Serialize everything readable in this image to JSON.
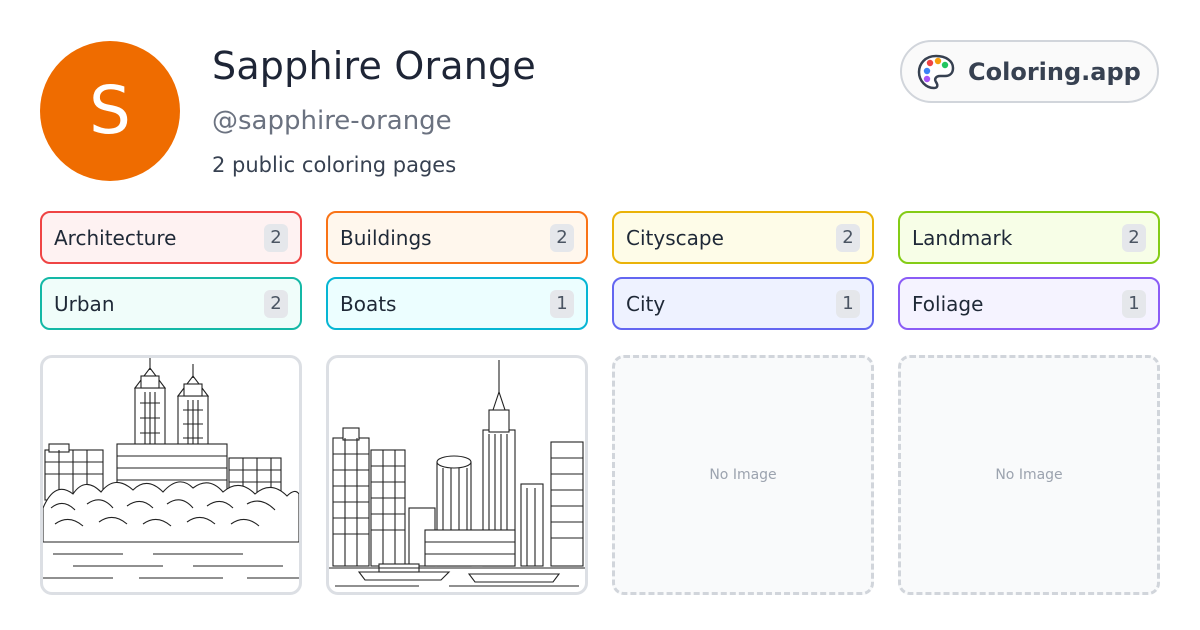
{
  "profile": {
    "initial": "S",
    "avatar_color": "#ef6c00",
    "name": "Sapphire Orange",
    "handle": "@sapphire-orange",
    "page_count": "2 public coloring pages"
  },
  "brand": {
    "label": "Coloring.app",
    "icon": "palette-icon"
  },
  "tags": [
    {
      "label": "Architecture",
      "count": "2",
      "border": "#ef4444",
      "bg": "#fef2f2"
    },
    {
      "label": "Buildings",
      "count": "2",
      "border": "#f97316",
      "bg": "#fff7ed"
    },
    {
      "label": "Cityscape",
      "count": "2",
      "border": "#eab308",
      "bg": "#fefce8"
    },
    {
      "label": "Landmark",
      "count": "2",
      "border": "#84cc16",
      "bg": "#f7fee7"
    },
    {
      "label": "Urban",
      "count": "2",
      "border": "#14b8a6",
      "bg": "#f0fdfa"
    },
    {
      "label": "Boats",
      "count": "1",
      "border": "#06b6d4",
      "bg": "#ecfeff"
    },
    {
      "label": "City",
      "count": "1",
      "border": "#6366f1",
      "bg": "#eef2ff"
    },
    {
      "label": "Foliage",
      "count": "1",
      "border": "#8b5cf6",
      "bg": "#f5f3ff"
    }
  ],
  "cards": [
    {
      "type": "image",
      "subject": "twin-tower-skyline-over-trees"
    },
    {
      "type": "image",
      "subject": "empire-state-skyline-over-water"
    },
    {
      "type": "empty",
      "label": "No Image"
    },
    {
      "type": "empty",
      "label": "No Image"
    }
  ]
}
